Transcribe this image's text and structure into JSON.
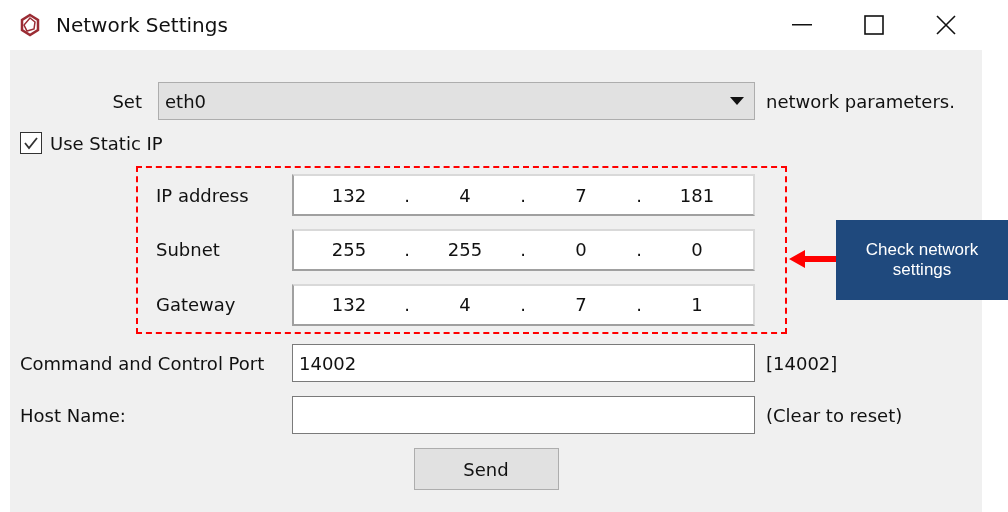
{
  "window": {
    "title": "Network Settings"
  },
  "interface": {
    "label": "Set",
    "value": "eth0",
    "suffix": "network parameters."
  },
  "static_ip": {
    "label": "Use Static IP",
    "checked": true
  },
  "ip_fields": [
    {
      "label": "IP address",
      "octets": [
        "132",
        "4",
        "7",
        "181"
      ],
      "separators": [
        ".",
        ".",
        "."
      ]
    },
    {
      "label": "Subnet",
      "octets": [
        "255",
        "255",
        "0",
        "0"
      ],
      "separators": [
        ".",
        ".",
        "."
      ]
    },
    {
      "label": "Gateway",
      "octets": [
        "132",
        "4",
        "7",
        "1"
      ],
      "separators": [
        ".",
        ".",
        "."
      ]
    }
  ],
  "port": {
    "label": "Command and Control Port",
    "value": "14002",
    "hint": "[14002]"
  },
  "host": {
    "label": "Host Name:",
    "hint": "(Clear to reset)"
  },
  "send_button": "Send",
  "callout": {
    "text": "Check network settings"
  }
}
